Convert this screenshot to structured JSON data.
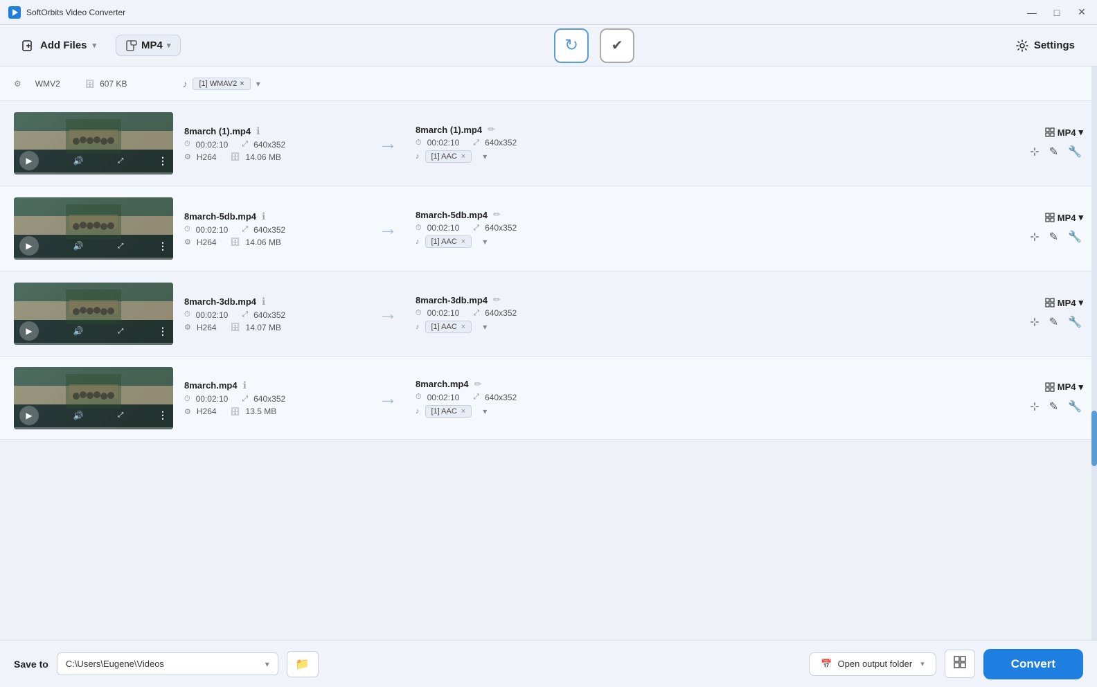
{
  "app": {
    "title": "SoftOrbits Video Converter"
  },
  "titlebar": {
    "minimize": "—",
    "maximize": "□",
    "close": "✕"
  },
  "toolbar": {
    "add_files": "Add Files",
    "format": "MP4",
    "refresh_icon": "↻",
    "check_icon": "✓",
    "settings": "Settings"
  },
  "partial_row": {
    "format": "WMV2",
    "size": "607 KB",
    "audio_badge": "[1] WMAV2"
  },
  "files": [
    {
      "name": "8march (1).mp4",
      "duration": "00:02:10",
      "resolution": "640x352",
      "codec": "H264",
      "size": "14.06 MB",
      "output_name": "8march (1).mp4",
      "output_duration": "00:02:10",
      "output_resolution": "640x352",
      "audio_badge": "[1] AAC",
      "output_format": "MP4"
    },
    {
      "name": "8march-5db.mp4",
      "duration": "00:02:10",
      "resolution": "640x352",
      "codec": "H264",
      "size": "14.06 MB",
      "output_name": "8march-5db.mp4",
      "output_duration": "00:02:10",
      "output_resolution": "640x352",
      "audio_badge": "[1] AAC",
      "output_format": "MP4"
    },
    {
      "name": "8march-3db.mp4",
      "duration": "00:02:10",
      "resolution": "640x352",
      "codec": "H264",
      "size": "14.07 MB",
      "output_name": "8march-3db.mp4",
      "output_duration": "00:02:10",
      "output_resolution": "640x352",
      "audio_badge": "[1] AAC",
      "output_format": "MP4"
    },
    {
      "name": "8march.mp4",
      "duration": "00:02:10",
      "resolution": "640x352",
      "codec": "H264",
      "size": "13.5 MB",
      "output_name": "8march.mp4",
      "output_duration": "00:02:10",
      "output_resolution": "640x352",
      "audio_badge": "[1] AAC",
      "output_format": "MP4"
    }
  ],
  "bottom": {
    "save_to_label": "Save to",
    "path": "C:\\Users\\Eugene\\Videos",
    "open_folder_label": "Open output folder",
    "convert_label": "Convert"
  },
  "icons": {
    "clock": "⏱",
    "resize": "⤢",
    "gear": "⚙",
    "database": "🗄",
    "music": "♪",
    "edit": "✏",
    "crop": "⊹",
    "write": "✎",
    "wrench": "🔧",
    "arrow_right": "→",
    "chevron_down": "▾",
    "folder": "📁",
    "calendar": "📅"
  }
}
